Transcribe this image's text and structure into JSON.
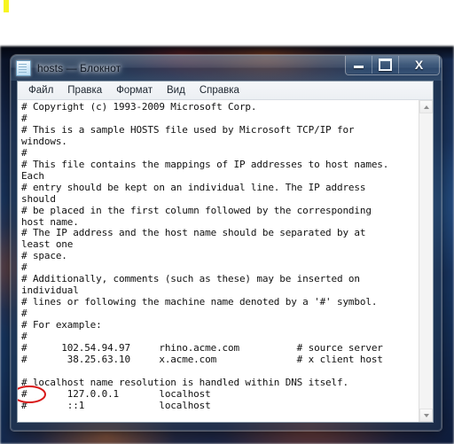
{
  "desktop": {
    "wallpaper_description": "blurred dark blue wallpaper with orange highlights",
    "marker_color": "#f7f520"
  },
  "window": {
    "title": "hosts — Блокнот",
    "icon": "notepad-document-icon",
    "controls": {
      "minimize_label": "—",
      "maximize_label": "□",
      "close_label": "X"
    },
    "menu": [
      {
        "label": "Файл"
      },
      {
        "label": "Правка"
      },
      {
        "label": "Формат"
      },
      {
        "label": "Вид"
      },
      {
        "label": "Справка"
      }
    ],
    "scrollbar": {
      "up_arrow": "▲",
      "down_arrow": "▼"
    },
    "document": {
      "lines": [
        "# Copyright (c) 1993-2009 Microsoft Corp.",
        "#",
        "# This is a sample HOSTS file used by Microsoft TCP/IP for",
        "windows.",
        "#",
        "# This file contains the mappings of IP addresses to host names.",
        "Each",
        "# entry should be kept on an individual line. The IP address",
        "should",
        "# be placed in the first column followed by the corresponding",
        "host name.",
        "# The IP address and the host name should be separated by at",
        "least one",
        "# space.",
        "#",
        "# Additionally, comments (such as these) may be inserted on",
        "individual",
        "# lines or following the machine name denoted by a '#' symbol.",
        "#",
        "# For example:",
        "#",
        "#      102.54.94.97     rhino.acme.com          # source server",
        "#       38.25.63.10     x.acme.com              # x client host",
        "",
        "# localhost name resolution is handled within DNS itself.",
        "#       127.0.0.1       localhost",
        "#       ::1             localhost"
      ]
    }
  },
  "annotation": {
    "shape": "ellipse",
    "color": "#d81818",
    "target_text": "#",
    "target_line": "#       127.0.0.1       localhost"
  }
}
